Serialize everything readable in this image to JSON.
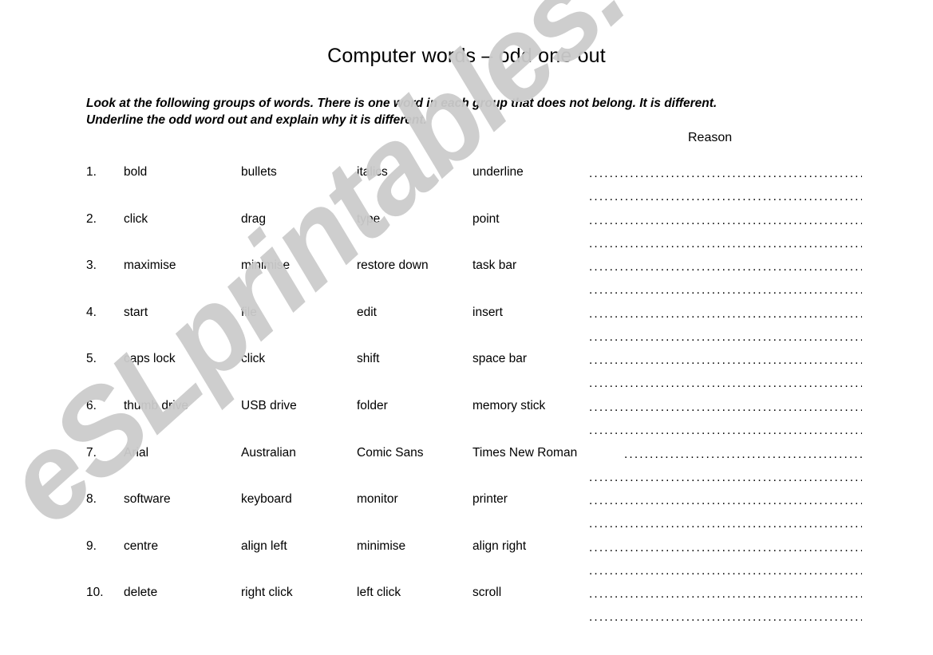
{
  "document": {
    "title": "Computer words – odd one out",
    "instructions_line1": "Look at the following groups of words.  There is one word in each group that does not belong.  It is different.",
    "instructions_line2": "Underline the odd word out and explain why it is different.",
    "reason_header": "Reason",
    "watermark": "eSLprintables.com",
    "watermark_color": "#cccccc",
    "text_color": "#000000",
    "background_color": "#ffffff",
    "answer_line_dots": "...........................................................................",
    "answer_line_dots_short": "...............................................................",
    "columns": 4,
    "rows": [
      {
        "number": "1.",
        "word1": "bold",
        "word2": "bullets",
        "word3": "italics",
        "word4": "underline"
      },
      {
        "number": "2.",
        "word1": "click",
        "word2": "drag",
        "word3": "type",
        "word4": "point"
      },
      {
        "number": "3.",
        "word1": "maximise",
        "word2": "minimise",
        "word3": "restore down",
        "word4": "task bar"
      },
      {
        "number": "4.",
        "word1": "start",
        "word2": "file",
        "word3": "edit",
        "word4": "insert"
      },
      {
        "number": "5.",
        "word1": "caps lock",
        "word2": "click",
        "word3": "shift",
        "word4": "space bar"
      },
      {
        "number": "6.",
        "word1": "thumb drive",
        "word2": "USB drive",
        "word3": "folder",
        "word4": "memory stick"
      },
      {
        "number": "7.",
        "word1": "Arial",
        "word2": "Australian",
        "word3": "Comic Sans",
        "word4": "Times New Roman"
      },
      {
        "number": "8.",
        "word1": "software",
        "word2": "keyboard",
        "word3": "monitor",
        "word4": "printer"
      },
      {
        "number": "9.",
        "word1": "centre",
        "word2": "align left",
        "word3": "minimise",
        "word4": "align right"
      },
      {
        "number": "10.",
        "word1": "delete",
        "word2": "right click",
        "word3": "left click",
        "word4": "scroll"
      }
    ]
  }
}
